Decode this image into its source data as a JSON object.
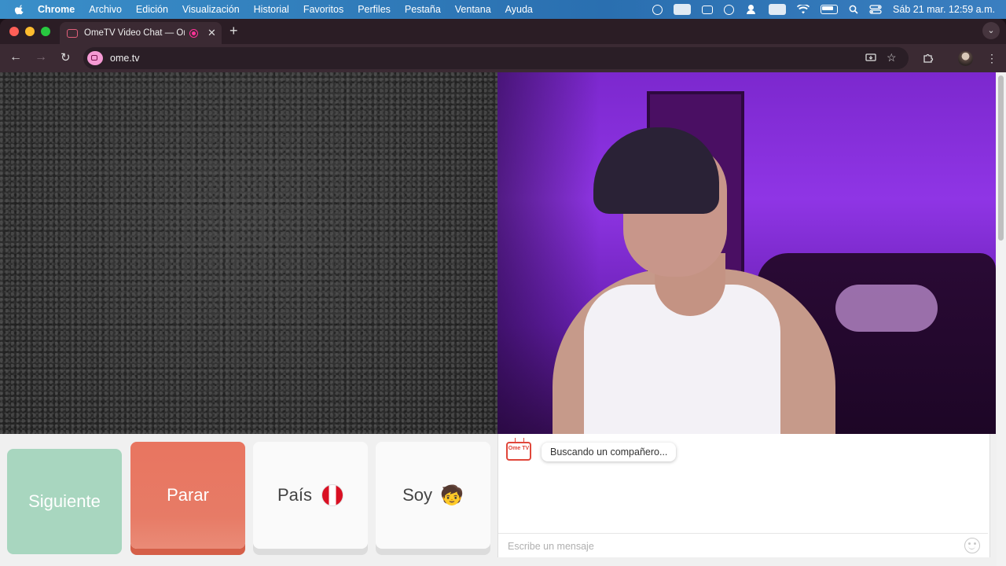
{
  "menubar": {
    "app": "Chrome",
    "items": [
      "Archivo",
      "Edición",
      "Visualización",
      "Historial",
      "Favoritos",
      "Perfiles",
      "Pestaña",
      "Ventana",
      "Ayuda"
    ],
    "clock": "Sáb 21 mar.  12:59 a.m."
  },
  "browser": {
    "tab_title": "OmeTV Video Chat — Ome",
    "url": "ome.tv"
  },
  "controls": {
    "next_label": "Siguiente",
    "stop_label": "Parar",
    "country_label": "País",
    "me_label": "Soy",
    "me_emoji": "🧒"
  },
  "chat": {
    "logo_text": "Ome TV",
    "status_message": "Buscando un compañero...",
    "input_placeholder": "Escribe un mensaje"
  },
  "colors": {
    "next_button": "#a8d6bf",
    "stop_button": "#e87560",
    "brand_red": "#e0463a"
  }
}
